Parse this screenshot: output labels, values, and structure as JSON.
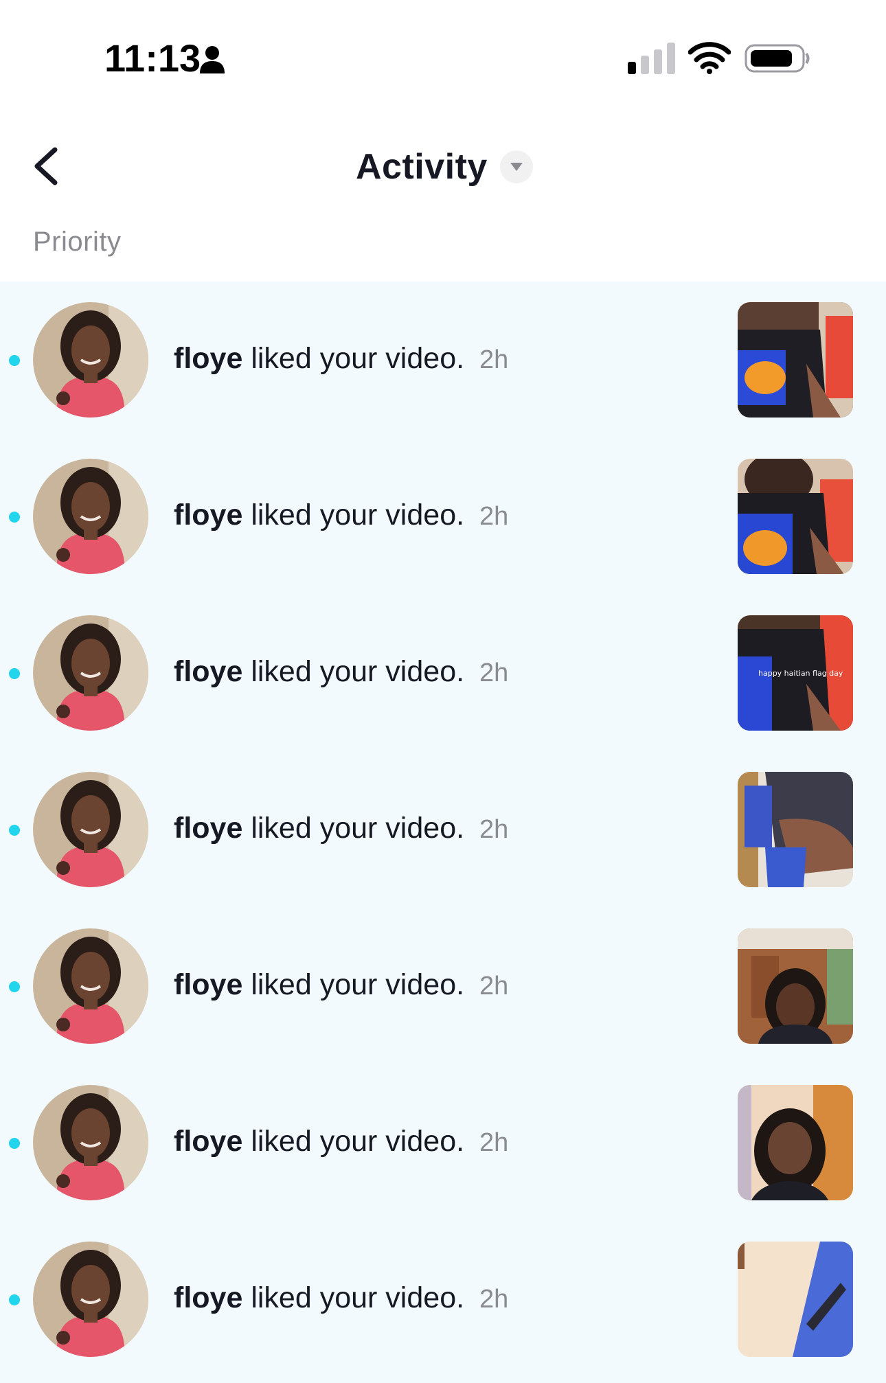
{
  "status_bar": {
    "time": "11:13",
    "icons": [
      "person-icon",
      "cellular-signal-icon",
      "wifi-icon",
      "battery-icon"
    ]
  },
  "header": {
    "back_icon": "chevron-left-icon",
    "title": "Activity",
    "title_dropdown_icon": "caret-down-icon"
  },
  "section": {
    "label": "Priority"
  },
  "colors": {
    "unread_dot": "#20d5ec",
    "list_background": "#f2fafd",
    "secondary_text": "#8a8b91"
  },
  "activities": [
    {
      "user": "floye",
      "action": "liked your video.",
      "time": "2h",
      "thumb_caption": ""
    },
    {
      "user": "floye",
      "action": "liked your video.",
      "time": "2h",
      "thumb_caption": ""
    },
    {
      "user": "floye",
      "action": "liked your video.",
      "time": "2h",
      "thumb_caption": "happy haitian flag day"
    },
    {
      "user": "floye",
      "action": "liked your video.",
      "time": "2h",
      "thumb_caption": ""
    },
    {
      "user": "floye",
      "action": "liked your video.",
      "time": "2h",
      "thumb_caption": ""
    },
    {
      "user": "floye",
      "action": "liked your video.",
      "time": "2h",
      "thumb_caption": ""
    },
    {
      "user": "floye",
      "action": "liked your video.",
      "time": "2h",
      "thumb_caption": ""
    }
  ]
}
